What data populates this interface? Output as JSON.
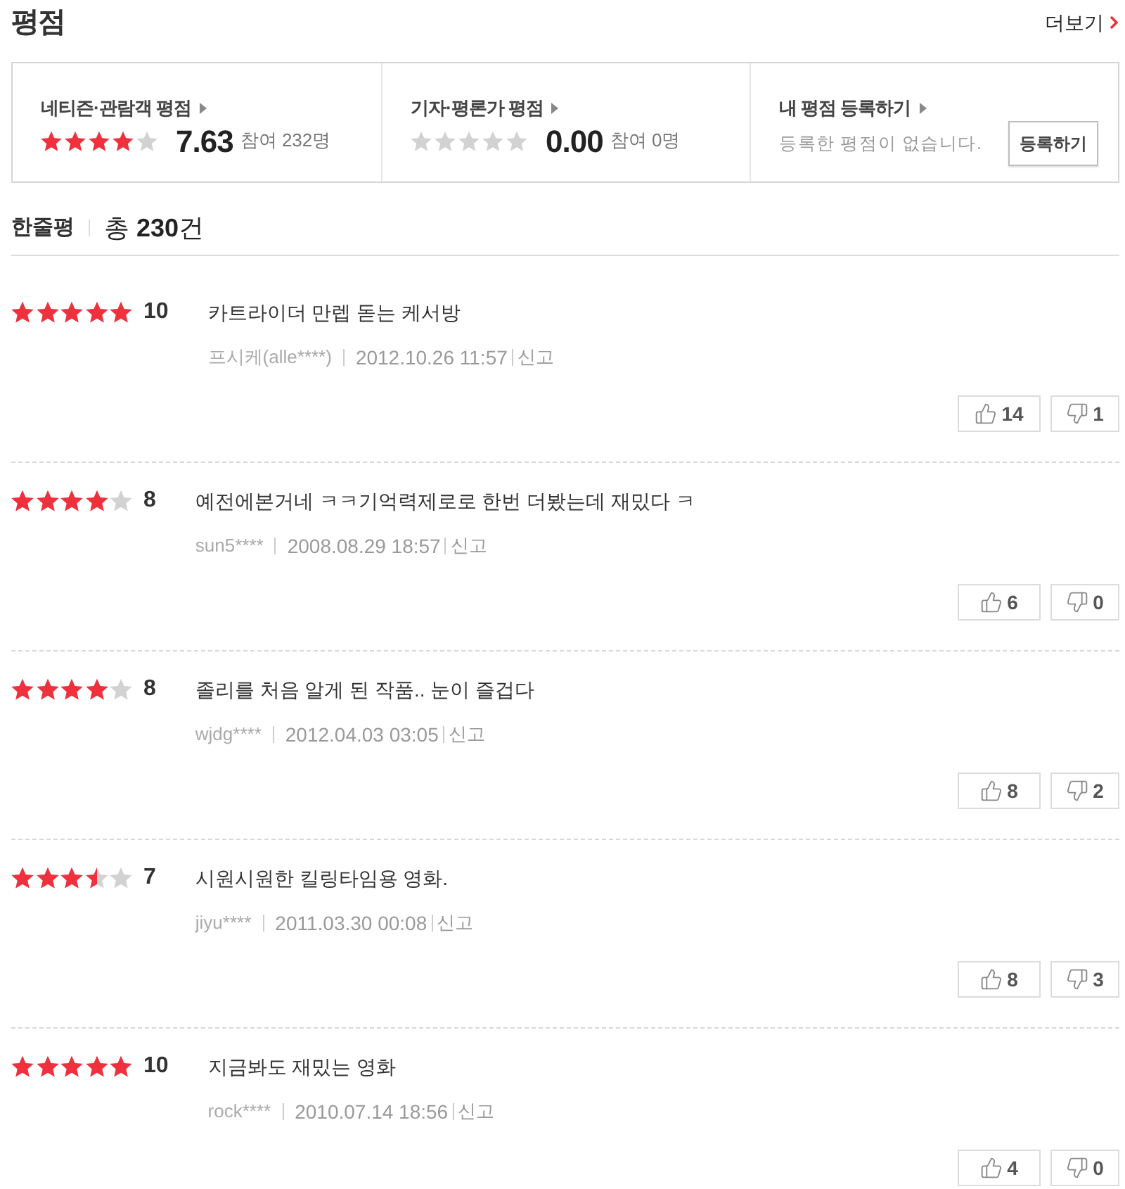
{
  "title": "평점",
  "more_link": "더보기",
  "summary": [
    {
      "label": "네티즌·관람객 평점",
      "stars": 4,
      "score": "7.63",
      "participants": "참여 232명"
    },
    {
      "label": "기자·평론가 평점",
      "stars": 0,
      "score": "0.00",
      "participants": "참여 0명"
    }
  ],
  "my_rating": {
    "label": "내 평점 등록하기",
    "message": "등록한 평점이 없습니다.",
    "button": "등록하기"
  },
  "reviews_header": {
    "title": "한줄평",
    "total": "총 **230**건"
  },
  "reviews": [
    {
      "stars": 5,
      "score": "10",
      "comment": "카트라이더 만렙 돋는 케서방",
      "author": "프시케(alle****)",
      "date": "2012.10.26 11:57",
      "report": "신고",
      "likes": "14",
      "dislikes": "1"
    },
    {
      "stars": 4,
      "score": "8",
      "comment": "예전에본거네 ㅋㅋ기억력제로로 한번 더봤는데 재밌다 ㅋ",
      "author": "sun5****",
      "date": "2008.08.29 18:57",
      "report": "신고",
      "likes": "6",
      "dislikes": "0"
    },
    {
      "stars": 4,
      "score": "8",
      "comment": "졸리를 처음 알게 된 작품.. 눈이 즐겁다",
      "author": "wjdg****",
      "date": "2012.04.03 03:05",
      "report": "신고",
      "likes": "8",
      "dislikes": "2"
    },
    {
      "stars": 3.5,
      "score": "7",
      "comment": "시원시원한 킬링타임용 영화.",
      "author": "jiyu****",
      "date": "2011.03.30 00:08",
      "report": "신고",
      "likes": "8",
      "dislikes": "3"
    },
    {
      "stars": 5,
      "score": "10",
      "comment": "지금봐도 재밌는 영화",
      "author": "rock****",
      "date": "2010.07.14 18:56",
      "report": "신고",
      "likes": "4",
      "dislikes": "0"
    }
  ]
}
